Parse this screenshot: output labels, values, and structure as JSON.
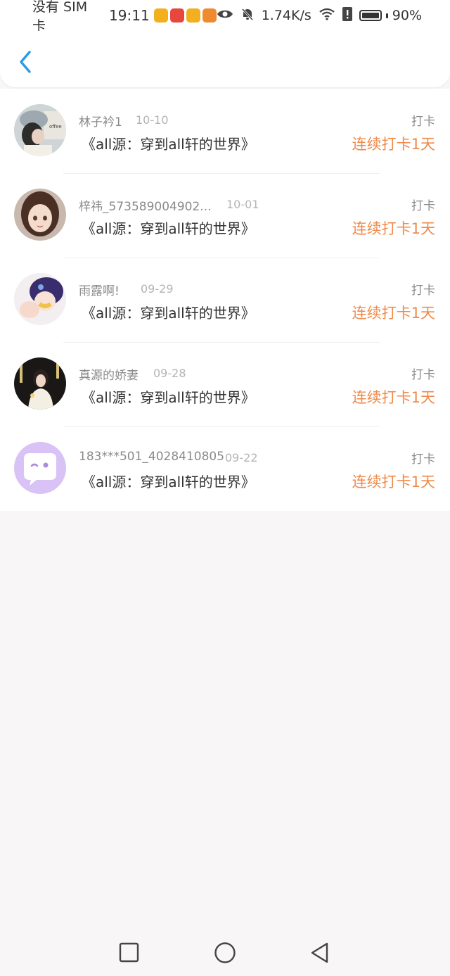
{
  "status_bar": {
    "carrier": "没有 SIM 卡",
    "time": "19:11",
    "network_speed": "1.74K/s",
    "battery": "90%",
    "app_icons": [
      "weibo-icon",
      "huawei-store-icon",
      "weibo-icon",
      "video-icon"
    ],
    "colors": {
      "weibo": "#f2b01e",
      "store": "#e8473d",
      "video": "#f08a2e"
    }
  },
  "header": {
    "back_icon": "chevron-left-icon",
    "accent": "#2b9be6"
  },
  "items": [
    {
      "name": "林子衿1",
      "date": "10-10",
      "book": "《all源：穿到all轩的世界》",
      "tag": "打卡",
      "streak": "连续打卡1天",
      "avatar": "photo-avatar"
    },
    {
      "name": "梓祎_573589004902...",
      "date": "10-01",
      "book": "《all源：穿到all轩的世界》",
      "tag": "打卡",
      "streak": "连续打卡1天",
      "avatar": "illustration-avatar"
    },
    {
      "name": "雨露啊!",
      "date": "09-29",
      "book": "《all源：穿到all轩的世界》",
      "tag": "打卡",
      "streak": "连续打卡1天",
      "avatar": "anime-avatar"
    },
    {
      "name": "真源的娇妻",
      "date": "09-28",
      "book": "《all源：穿到all轩的世界》",
      "tag": "打卡",
      "streak": "连续打卡1天",
      "avatar": "stage-photo-avatar"
    },
    {
      "name": "183***501_4028410805",
      "date": "09-22",
      "book": "《all源：穿到all轩的世界》",
      "tag": "打卡",
      "streak": "连续打卡1天",
      "avatar": "default-chat-avatar"
    }
  ],
  "theme": {
    "streak_color": "#ef8a4a",
    "default_avatar_bg": "#d9c2f5"
  },
  "nav_bar": {
    "buttons": [
      "recent-apps-icon",
      "home-icon",
      "back-triangle-icon"
    ]
  }
}
